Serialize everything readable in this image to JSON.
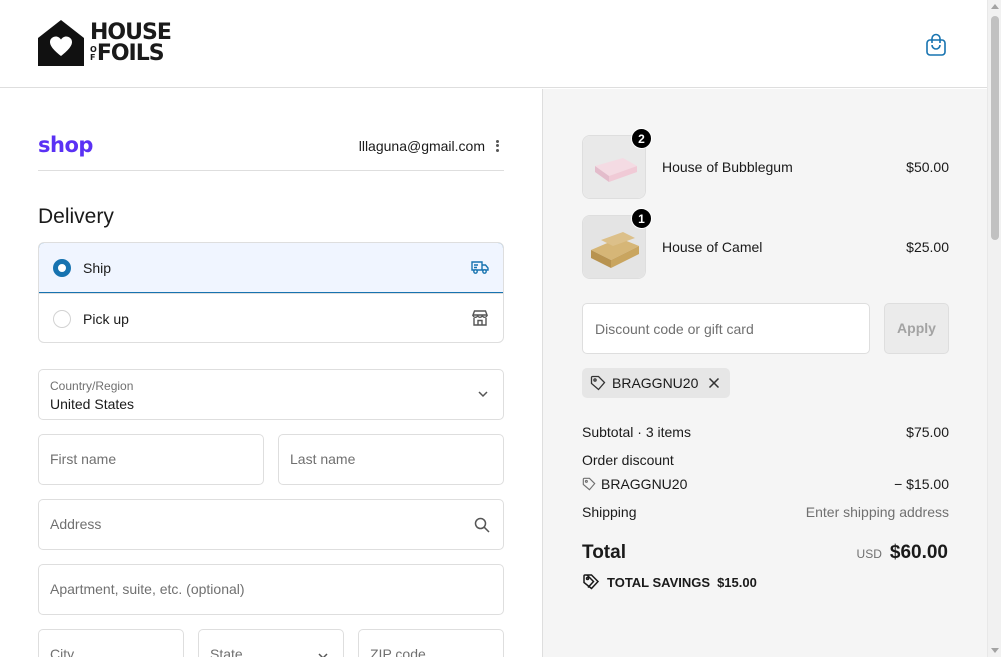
{
  "brand": {
    "line1": "HOUSE",
    "of_top": "O",
    "of_bottom": "F",
    "line2": "FOILS"
  },
  "account": {
    "shop_label": "shop",
    "email": "lllaguna@gmail.com"
  },
  "delivery": {
    "title": "Delivery",
    "options": [
      {
        "label": "Ship",
        "selected": true,
        "icon": "truck-icon"
      },
      {
        "label": "Pick up",
        "selected": false,
        "icon": "store-icon"
      }
    ]
  },
  "form": {
    "country_label": "Country/Region",
    "country_value": "United States",
    "first_name_placeholder": "First name",
    "last_name_placeholder": "Last name",
    "address_placeholder": "Address",
    "apartment_placeholder": "Apartment, suite, etc. (optional)",
    "city_placeholder": "City",
    "state_placeholder": "State",
    "zip_placeholder": "ZIP code"
  },
  "cart": {
    "items": [
      {
        "name": "House of Bubblegum",
        "price": "$50.00",
        "qty": "2",
        "color": "#e9c8d2"
      },
      {
        "name": "House of Camel",
        "price": "$25.00",
        "qty": "1",
        "color": "#c9a86a"
      }
    ]
  },
  "discount": {
    "placeholder": "Discount code or gift card",
    "apply_label": "Apply",
    "applied_code": "BRAGGNU20"
  },
  "summary": {
    "subtotal_label": "Subtotal · 3 items",
    "subtotal_value": "$75.00",
    "order_discount_label": "Order discount",
    "discount_code": "BRAGGNU20",
    "discount_value": "− $15.00",
    "shipping_label": "Shipping",
    "shipping_value": "Enter shipping address",
    "total_label": "Total",
    "currency": "USD",
    "total_value": "$60.00",
    "savings_label": "TOTAL SAVINGS",
    "savings_value": "$15.00"
  },
  "colors": {
    "accent": "#1773b0",
    "shop_purple": "#5a31f4",
    "summary_bg": "#f5f5f5"
  }
}
